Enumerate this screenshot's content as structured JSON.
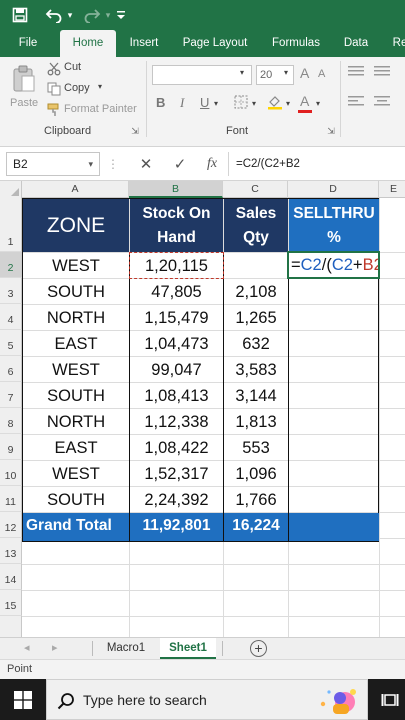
{
  "titlebar": {
    "icons": [
      "save-icon",
      "undo-icon",
      "undo-dropdown-icon",
      "redo-icon",
      "redo-dropdown-icon",
      "customize-qat-icon"
    ],
    "accent": "#217346"
  },
  "ribbon_tabs": [
    "File",
    "Home",
    "Insert",
    "Page Layout",
    "Formulas",
    "Data",
    "Re"
  ],
  "ribbon_active_tab": "Home",
  "clipboard": {
    "paste": "Paste",
    "cut": "Cut",
    "copy": "Copy",
    "format_painter": "Format Painter",
    "group_label": "Clipboard"
  },
  "font": {
    "size": "20",
    "bold": "B",
    "italic": "I",
    "underline": "U",
    "increase": "A",
    "decrease": "A",
    "color": "A",
    "group_label": "Font"
  },
  "formula_bar": {
    "name_box": "B2",
    "cancel": "✕",
    "enter": "✓",
    "fx": "fx",
    "formula": "=C2/(C2+B2"
  },
  "columns": [
    "A",
    "B",
    "C",
    "D",
    "E"
  ],
  "rows": [
    "1",
    "2",
    "3",
    "4",
    "5",
    "6",
    "7",
    "8",
    "9",
    "10",
    "11",
    "12",
    "13",
    "14",
    "15"
  ],
  "table": {
    "headers": [
      {
        "line1": "ZONE",
        "line2": ""
      },
      {
        "line1": "Stock On",
        "line2": "Hand"
      },
      {
        "line1": "Sales",
        "line2": "Qty"
      },
      {
        "line1": "SELLTHRU",
        "line2": "%"
      }
    ],
    "rows": [
      {
        "zone": "WEST",
        "stock": "1,20,115",
        "sales": ""
      },
      {
        "zone": "SOUTH",
        "stock": "47,805",
        "sales": "2,108"
      },
      {
        "zone": "NORTH",
        "stock": "1,15,479",
        "sales": "1,265"
      },
      {
        "zone": "EAST",
        "stock": "1,04,473",
        "sales": "632"
      },
      {
        "zone": "WEST",
        "stock": "99,047",
        "sales": "3,583"
      },
      {
        "zone": "SOUTH",
        "stock": "1,08,413",
        "sales": "3,144"
      },
      {
        "zone": "NORTH",
        "stock": "1,12,338",
        "sales": "1,813"
      },
      {
        "zone": "EAST",
        "stock": "1,08,422",
        "sales": "553"
      },
      {
        "zone": "WEST",
        "stock": "1,52,317",
        "sales": "1,096"
      },
      {
        "zone": "SOUTH",
        "stock": "2,24,392",
        "sales": "1,766"
      }
    ],
    "total": {
      "label": "Grand Total",
      "stock": "11,92,801",
      "sales": "16,224"
    },
    "editing_cell": {
      "eq": "=",
      "c2a": "C2",
      "op1": "/(",
      "c2b": "C2",
      "op2": "+",
      "b2": "B2"
    },
    "colors": {
      "header_bg": "#1f3864",
      "header_accent_bg": "#1f6fc0",
      "ref_c2": "#1f5fbf",
      "ref_b2": "#c0392b"
    }
  },
  "sheets": [
    "Macro1",
    "Sheet1"
  ],
  "active_sheet": "Sheet1",
  "status": "Point",
  "taskbar": {
    "search_placeholder": "Type here to search",
    "icons": [
      "windows-start-icon",
      "search-icon",
      "search-highlight-icon",
      "task-view-icon"
    ]
  }
}
